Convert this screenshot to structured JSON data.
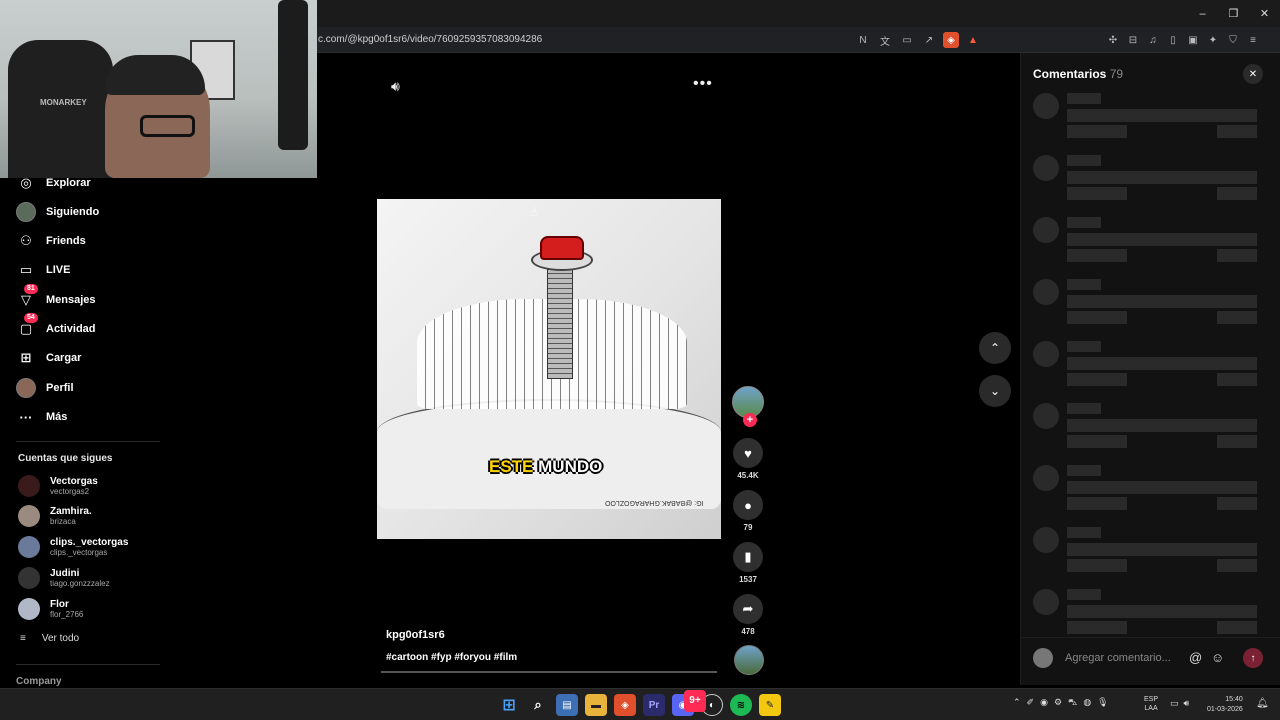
{
  "browser": {
    "url": "c.com/@kpg0of1sr6/video/7609259357083094286",
    "window_controls": [
      "–",
      "❐",
      "✕"
    ]
  },
  "webcam": {
    "chair_brand": "MONARKEY"
  },
  "sidebar": {
    "items": [
      {
        "label": "Explorar",
        "icon": "compass-icon"
      },
      {
        "label": "Siguiendo",
        "icon": "following-avatar"
      },
      {
        "label": "Friends",
        "icon": "friends-icon"
      },
      {
        "label": "LIVE",
        "icon": "live-icon"
      },
      {
        "label": "Mensajes",
        "icon": "messages-icon",
        "badge": "81"
      },
      {
        "label": "Actividad",
        "icon": "activity-icon",
        "badge": "54"
      },
      {
        "label": "Cargar",
        "icon": "upload-icon"
      },
      {
        "label": "Perfil",
        "icon": "profile-avatar"
      },
      {
        "label": "Más",
        "icon": "more-icon"
      }
    ],
    "following_title": "Cuentas que sigues",
    "following": [
      {
        "name": "Vectorgas",
        "handle": "vectorgas2"
      },
      {
        "name": "Zamhira.",
        "handle": "brizaca"
      },
      {
        "name": "clips._vectorgas",
        "handle": "clips._vectorgas"
      },
      {
        "name": "Judini",
        "handle": "tiago.gonzzzalez"
      },
      {
        "name": "Flor",
        "handle": "flor_2766"
      }
    ],
    "see_all": "Ver todo",
    "footer": "Company"
  },
  "video": {
    "caption_highlight": "ESTE",
    "caption_rest": " MUNDO",
    "watermark": "IG: @BABAK.GHARAGOZLOO",
    "author": "kpg0of1sr6",
    "tags": "#cartoon #fyp #foryou #film"
  },
  "actions": {
    "likes": "45.4K",
    "comments": "79",
    "saves": "1537",
    "shares": "478"
  },
  "comments_panel": {
    "title": "Comentarios",
    "count": "79",
    "placeholder": "Agregar comentario..."
  },
  "taskbar": {
    "lang_top": "ESP",
    "lang_bottom": "LAA",
    "time": "15:40",
    "date": "01-03-2026",
    "discord_badge": "9+"
  },
  "colors": {
    "accent": "#fe2c55",
    "background": "#000000",
    "panel": "#121212",
    "skeleton": "#2a2a2a"
  }
}
